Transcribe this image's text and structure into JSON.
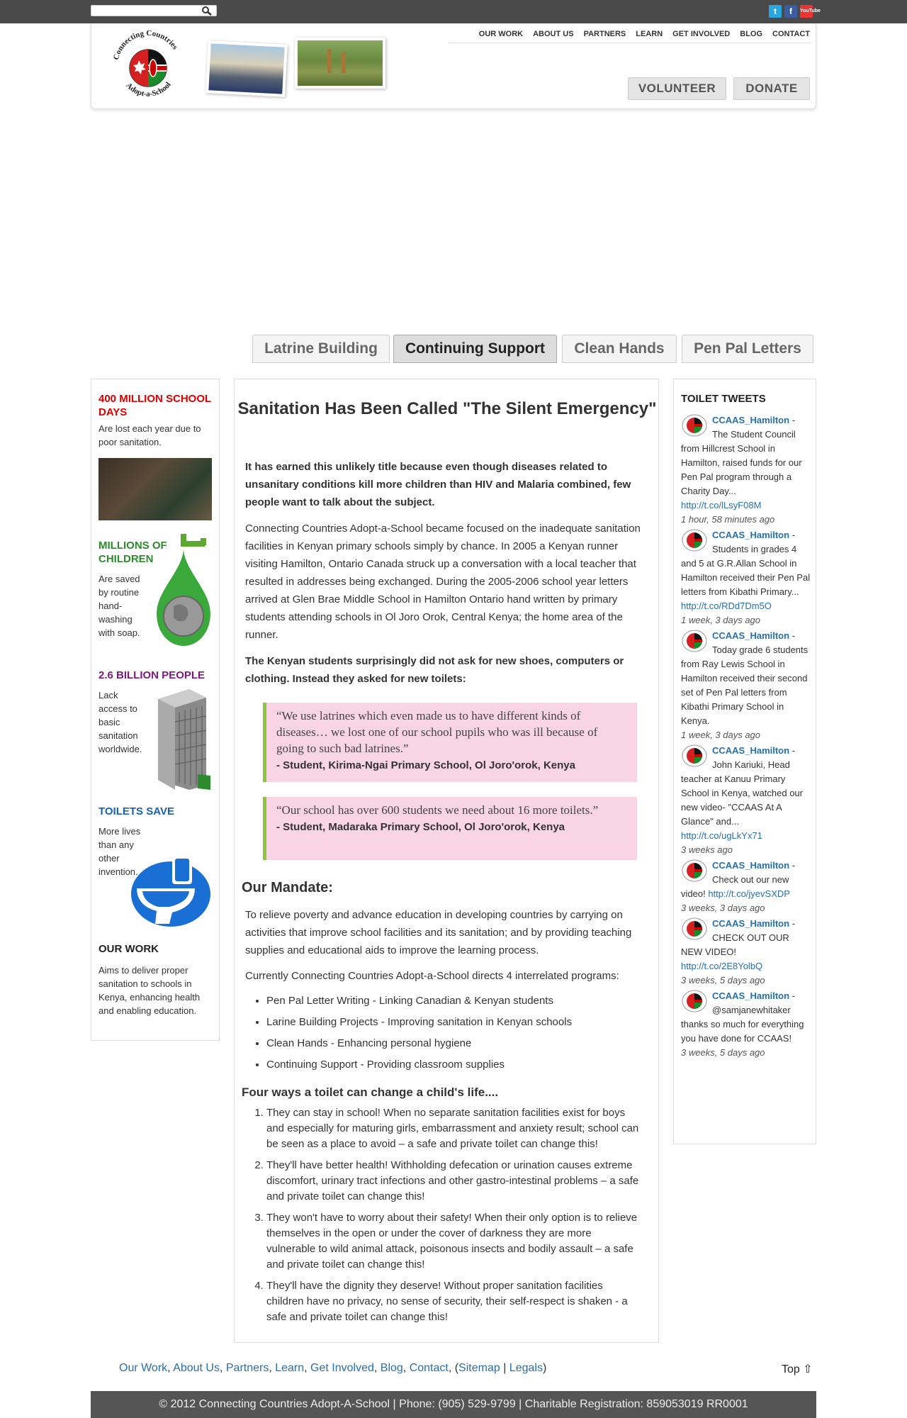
{
  "header": {
    "search_placeholder": "",
    "logo_text_top": "Connecting Countries",
    "logo_text_bottom": "Adopt-a-School",
    "nav": [
      "OUR WORK",
      "ABOUT US",
      "PARTNERS",
      "LEARN",
      "GET INVOLVED",
      "BLOG",
      "CONTACT"
    ],
    "volunteer": "VOLUNTEER",
    "donate": "DONATE",
    "social": {
      "twitter": "t",
      "facebook": "f",
      "youtube": "YouTube"
    }
  },
  "tabs": [
    "Latrine Building",
    "Continuing Support",
    "Clean Hands",
    "Pen Pal Letters"
  ],
  "active_tab": "Continuing Support",
  "left": {
    "f1_title": "400 MILLION SCHOOL DAYS",
    "f1_text": "Are lost each year due to poor sanitation.",
    "f2_title": "MILLIONS OF CHILDREN",
    "f2_text": "Are saved by routine hand-washing with soap.",
    "f3_title": "2.6 BILLION PEOPLE",
    "f3_text": "Lack access to basic sanitation worldwide.",
    "f4_title": "TOILETS SAVE",
    "f4_text": "More lives than any other invention.",
    "f5_title": "OUR WORK",
    "f5_text": "Aims to deliver proper sanitation to schools in Kenya, enhancing health and enabling education."
  },
  "main": {
    "title": "Sanitation Has Been Called \"The Silent Emergency\"",
    "intro": "It has earned this unlikely title because even though diseases related to unsanitary conditions kill more children than HIV and Malaria combined, few people want to talk about the subject.",
    "para1": "Connecting Countries Adopt-a-School became focused on the inadequate sanitation facilities in Kenyan primary schools simply by chance. In 2005 a Kenyan runner visiting Hamilton, Ontario Canada struck up a conversation with a local teacher that resulted in addresses being exchanged. During the 2005-2006 school year letters arrived at Glen Brae Middle School in Hamilton Ontario hand written by primary students attending schools in Ol Joro Orok, Central Kenya; the home area of the runner.",
    "para2": "The Kenyan students surprisingly did not ask for new shoes, computers or clothing. Instead they asked for new toilets:",
    "q1_text": "“We use latrines which even made us to have different kinds of diseases… we lost one of our school pupils who was ill because of going to such bad latrines.”",
    "q1_attr": "- Student, Kirima-Ngai Primary School, Ol Joro'orok, Kenya",
    "q2_text": "“Our school has over 600 students we need about 16 more toilets.”",
    "q2_attr": "- Student, Madaraka Primary School, Ol Joro'orok, Kenya",
    "mandate_heading": "Our Mandate:",
    "mandate": "To relieve poverty and advance education in developing countries by carrying on activities that improve school facilities and its sanitation; and by providing teaching supplies and educational aids to improve the learning process.",
    "programs_intro": "Currently Connecting Countries Adopt-a-School directs 4 interrelated programs:",
    "programs": [
      "Pen Pal Letter Writing - Linking Canadian & Kenyan students",
      "Larine Building Projects - Improving sanitation in Kenyan schools",
      "Clean Hands - Enhancing personal hygiene",
      "Continuing Support - Providing classroom supplies"
    ],
    "four_heading": "Four ways a toilet can change a child's life....",
    "four": [
      "They can stay in school! When no separate sanitation facilities exist for boys and especially for maturing girls, embarrassment and anxiety result; school can be seen as a place to avoid – a safe and private toilet can change this!",
      "They'll have better health! Withholding defecation or urination causes extreme discomfort, urinary tract infections and other gastro-intestinal problems – a safe and private toilet can change this!",
      "They won't have to worry about their safety! When their only option is to relieve themselves in the open or under the cover of darkness they are more vulnerable to wild animal attack, poisonous insects and bodily assault – a safe and private toilet can change this!",
      "They'll have the dignity they deserve! Without proper sanitation facilities children have no privacy, no sense of security, their self-respect is shaken - a safe and private toilet can change this!"
    ]
  },
  "right": {
    "heading": "TOILET TWEETS",
    "tweets": [
      {
        "user": "CCAAS_Hamilton",
        "text": "The Student Council from Hillcrest School in Hamilton, raised funds for our Pen Pal program through a Charity Day...",
        "link": "http://t.co/lLsyF08M",
        "time": "1 hour, 58 minutes ago"
      },
      {
        "user": "CCAAS_Hamilton",
        "text": "Students in grades 4 and 5 at G.R.Allan School in Hamilton received their Pen Pal letters from Kibathi Primary...",
        "link": "http://t.co/RDd7Dm5O",
        "time": "1 week, 3 days ago"
      },
      {
        "user": "CCAAS_Hamilton",
        "text": "Today grade 6 students from Ray Lewis School in Hamilton received their second set of Pen Pal letters from Kibathi Primary School in Kenya.",
        "link": "",
        "time": "1 week, 3 days ago"
      },
      {
        "user": "CCAAS_Hamilton",
        "text": "John Kariuki, Head teacher at Kanuu Primary School in Kenya, watched our new video- \"CCAAS At A Glance\" and...",
        "link": "http://t.co/ugLkYx71",
        "time": "3 weeks ago"
      },
      {
        "user": "CCAAS_Hamilton",
        "text": "Check out our new video!",
        "link": "http://t.co/jyevSXDP",
        "time": "3 weeks, 3 days ago"
      },
      {
        "user": "CCAAS_Hamilton",
        "text": "CHECK OUT OUR NEW VIDEO!",
        "link": "http://t.co/2E8YolbQ",
        "time": "3 weeks, 5 days ago"
      },
      {
        "user": "CCAAS_Hamilton",
        "text": "@samjanewhitaker thanks so much for everything you have done for CCAAS!",
        "link": "",
        "time": "3 weeks, 5 days ago"
      }
    ]
  },
  "footer": {
    "links": [
      "Our Work",
      "About Us",
      "Partners",
      "Learn",
      "Get Involved",
      "Blog",
      "Contact"
    ],
    "sitemap": "Sitemap",
    "legals": "Legals",
    "top": "Top ⇧",
    "copyright": "© 2012 Connecting Countries Adopt-A-School | Phone: (905) 529-9799 | Charitable Registration: 859053019 RR0001"
  },
  "colors": {
    "topbar": "#4a4a4a",
    "accent_red": "#d00000",
    "accent_green": "#2d8a2d",
    "accent_purple": "#7a1a7a",
    "accent_blue": "#1a5fb4",
    "quote_bg": "#f9d4e4",
    "quote_border": "#8cc63f",
    "link": "#2a6fa8"
  }
}
